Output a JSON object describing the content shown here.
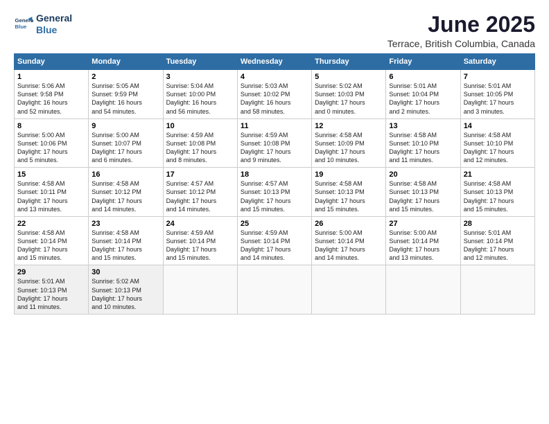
{
  "logo": {
    "line1": "General",
    "line2": "Blue"
  },
  "title": "June 2025",
  "location": "Terrace, British Columbia, Canada",
  "days_header": [
    "Sunday",
    "Monday",
    "Tuesday",
    "Wednesday",
    "Thursday",
    "Friday",
    "Saturday"
  ],
  "weeks": [
    [
      {
        "day": "1",
        "info": "Sunrise: 5:06 AM\nSunset: 9:58 PM\nDaylight: 16 hours\nand 52 minutes."
      },
      {
        "day": "2",
        "info": "Sunrise: 5:05 AM\nSunset: 9:59 PM\nDaylight: 16 hours\nand 54 minutes."
      },
      {
        "day": "3",
        "info": "Sunrise: 5:04 AM\nSunset: 10:00 PM\nDaylight: 16 hours\nand 56 minutes."
      },
      {
        "day": "4",
        "info": "Sunrise: 5:03 AM\nSunset: 10:02 PM\nDaylight: 16 hours\nand 58 minutes."
      },
      {
        "day": "5",
        "info": "Sunrise: 5:02 AM\nSunset: 10:03 PM\nDaylight: 17 hours\nand 0 minutes."
      },
      {
        "day": "6",
        "info": "Sunrise: 5:01 AM\nSunset: 10:04 PM\nDaylight: 17 hours\nand 2 minutes."
      },
      {
        "day": "7",
        "info": "Sunrise: 5:01 AM\nSunset: 10:05 PM\nDaylight: 17 hours\nand 3 minutes."
      }
    ],
    [
      {
        "day": "8",
        "info": "Sunrise: 5:00 AM\nSunset: 10:06 PM\nDaylight: 17 hours\nand 5 minutes."
      },
      {
        "day": "9",
        "info": "Sunrise: 5:00 AM\nSunset: 10:07 PM\nDaylight: 17 hours\nand 6 minutes."
      },
      {
        "day": "10",
        "info": "Sunrise: 4:59 AM\nSunset: 10:08 PM\nDaylight: 17 hours\nand 8 minutes."
      },
      {
        "day": "11",
        "info": "Sunrise: 4:59 AM\nSunset: 10:08 PM\nDaylight: 17 hours\nand 9 minutes."
      },
      {
        "day": "12",
        "info": "Sunrise: 4:58 AM\nSunset: 10:09 PM\nDaylight: 17 hours\nand 10 minutes."
      },
      {
        "day": "13",
        "info": "Sunrise: 4:58 AM\nSunset: 10:10 PM\nDaylight: 17 hours\nand 11 minutes."
      },
      {
        "day": "14",
        "info": "Sunrise: 4:58 AM\nSunset: 10:10 PM\nDaylight: 17 hours\nand 12 minutes."
      }
    ],
    [
      {
        "day": "15",
        "info": "Sunrise: 4:58 AM\nSunset: 10:11 PM\nDaylight: 17 hours\nand 13 minutes."
      },
      {
        "day": "16",
        "info": "Sunrise: 4:58 AM\nSunset: 10:12 PM\nDaylight: 17 hours\nand 14 minutes."
      },
      {
        "day": "17",
        "info": "Sunrise: 4:57 AM\nSunset: 10:12 PM\nDaylight: 17 hours\nand 14 minutes."
      },
      {
        "day": "18",
        "info": "Sunrise: 4:57 AM\nSunset: 10:13 PM\nDaylight: 17 hours\nand 15 minutes."
      },
      {
        "day": "19",
        "info": "Sunrise: 4:58 AM\nSunset: 10:13 PM\nDaylight: 17 hours\nand 15 minutes."
      },
      {
        "day": "20",
        "info": "Sunrise: 4:58 AM\nSunset: 10:13 PM\nDaylight: 17 hours\nand 15 minutes."
      },
      {
        "day": "21",
        "info": "Sunrise: 4:58 AM\nSunset: 10:13 PM\nDaylight: 17 hours\nand 15 minutes."
      }
    ],
    [
      {
        "day": "22",
        "info": "Sunrise: 4:58 AM\nSunset: 10:14 PM\nDaylight: 17 hours\nand 15 minutes."
      },
      {
        "day": "23",
        "info": "Sunrise: 4:58 AM\nSunset: 10:14 PM\nDaylight: 17 hours\nand 15 minutes."
      },
      {
        "day": "24",
        "info": "Sunrise: 4:59 AM\nSunset: 10:14 PM\nDaylight: 17 hours\nand 15 minutes."
      },
      {
        "day": "25",
        "info": "Sunrise: 4:59 AM\nSunset: 10:14 PM\nDaylight: 17 hours\nand 14 minutes."
      },
      {
        "day": "26",
        "info": "Sunrise: 5:00 AM\nSunset: 10:14 PM\nDaylight: 17 hours\nand 14 minutes."
      },
      {
        "day": "27",
        "info": "Sunrise: 5:00 AM\nSunset: 10:14 PM\nDaylight: 17 hours\nand 13 minutes."
      },
      {
        "day": "28",
        "info": "Sunrise: 5:01 AM\nSunset: 10:14 PM\nDaylight: 17 hours\nand 12 minutes."
      }
    ],
    [
      {
        "day": "29",
        "info": "Sunrise: 5:01 AM\nSunset: 10:13 PM\nDaylight: 17 hours\nand 11 minutes."
      },
      {
        "day": "30",
        "info": "Sunrise: 5:02 AM\nSunset: 10:13 PM\nDaylight: 17 hours\nand 10 minutes."
      },
      {
        "day": "",
        "info": ""
      },
      {
        "day": "",
        "info": ""
      },
      {
        "day": "",
        "info": ""
      },
      {
        "day": "",
        "info": ""
      },
      {
        "day": "",
        "info": ""
      }
    ]
  ]
}
